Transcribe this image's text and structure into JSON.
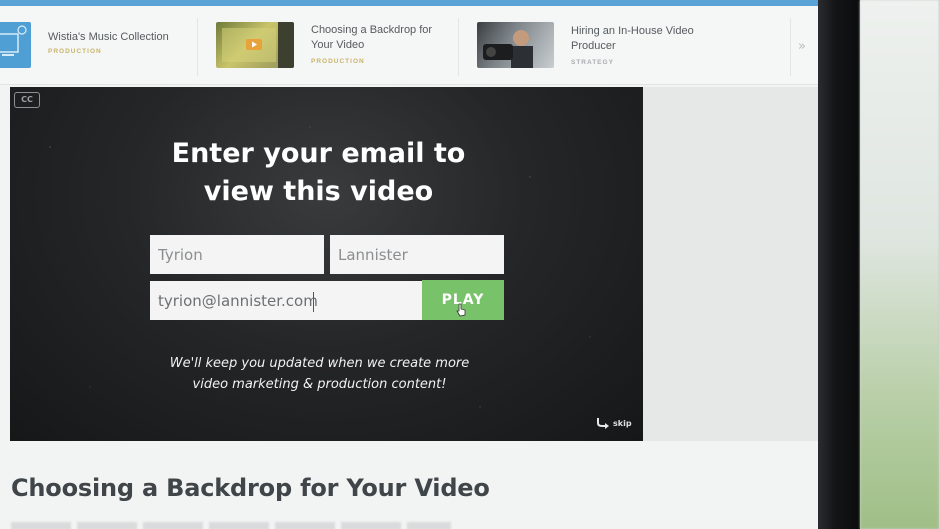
{
  "related": {
    "items": [
      {
        "title_line1": "Wistia's Music Collection",
        "title_line2": "",
        "tag": "PRODUCTION",
        "tag_color": "#c9b46a"
      },
      {
        "title_line1": "Choosing a Backdrop for",
        "title_line2": "Your Video",
        "tag": "PRODUCTION",
        "tag_color": "#c9b46a"
      },
      {
        "title_line1": "Hiring an In-House Video",
        "title_line2": "Producer",
        "tag": "STRATEGY",
        "tag_color": "#a9adaf"
      }
    ],
    "next_icon": "»"
  },
  "player": {
    "cc_label": "CC",
    "headline_line1": "Enter your email to",
    "headline_line2": "view this video",
    "first_name_value": "Tyrion",
    "last_name_value": "Lannister",
    "email_value": "tyrion@lannister.com",
    "play_label": "PLAY",
    "note_line1": "We'll keep you updated when we create more",
    "note_line2": "video marketing & production content!",
    "skip_label": "skip",
    "accent_color": "#78c26a"
  },
  "page": {
    "title": "Choosing a Backdrop for Your Video"
  }
}
